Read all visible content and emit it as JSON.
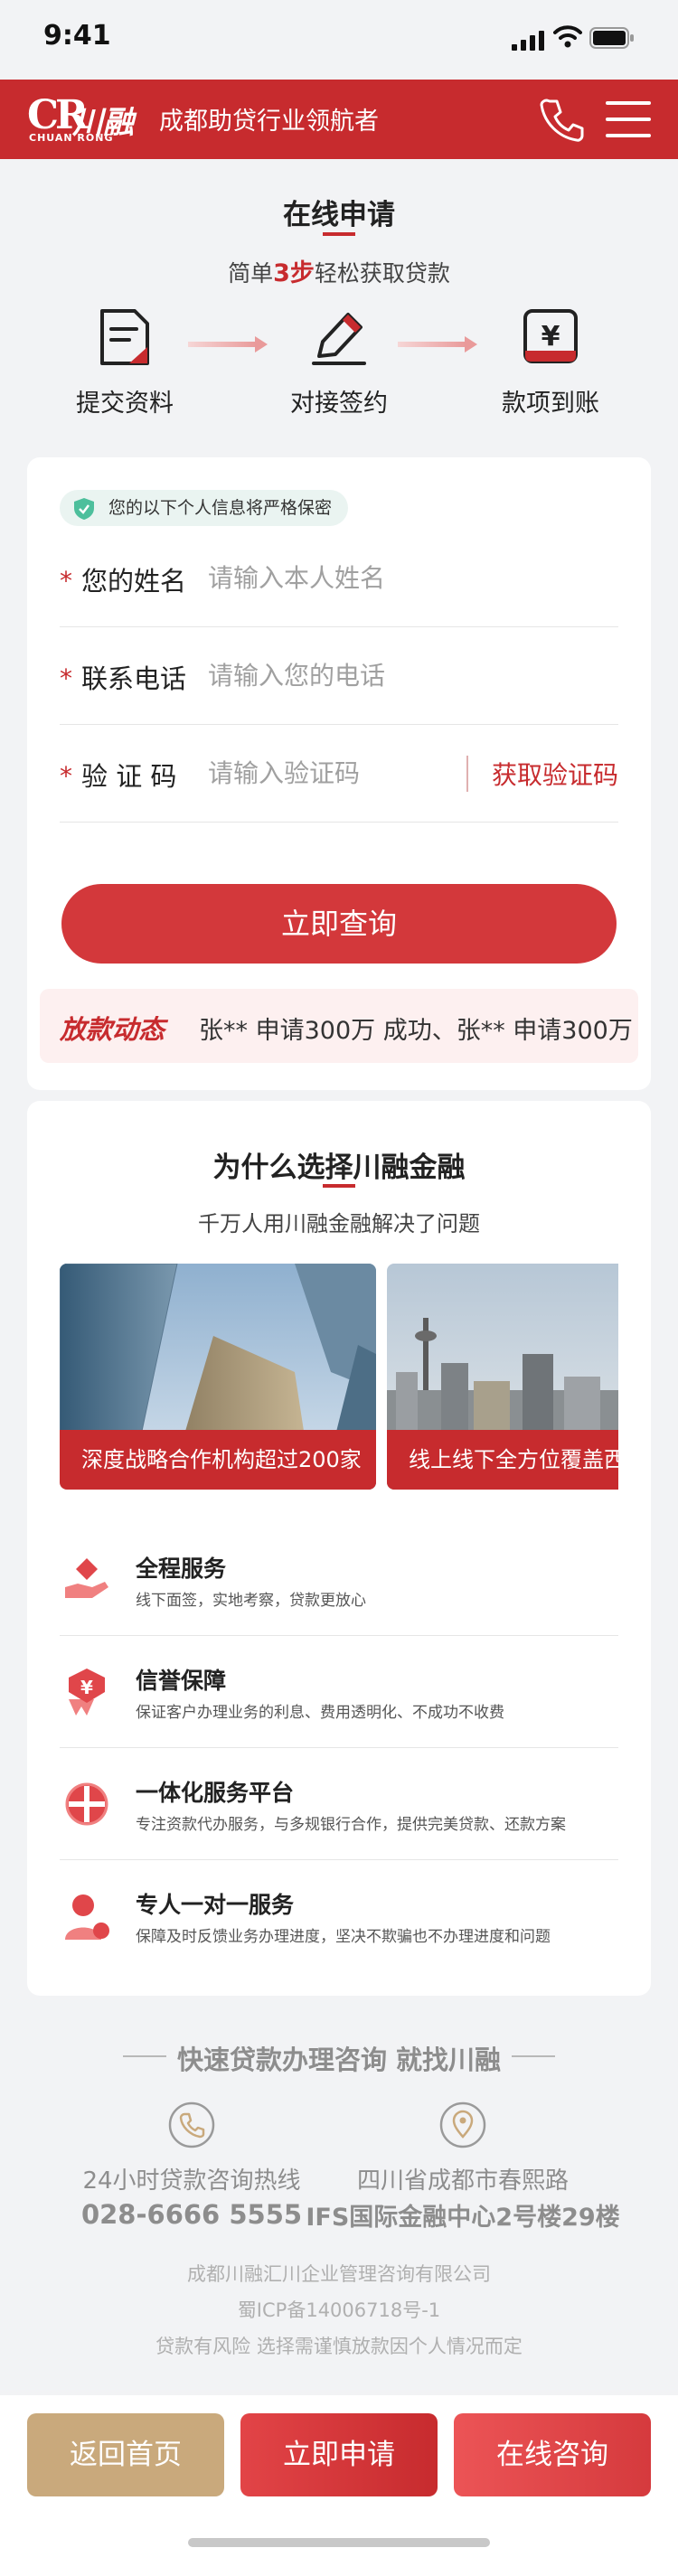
{
  "status_bar": {
    "time": "9:41"
  },
  "header": {
    "logo_mark": "CR",
    "logo_cn": "川融",
    "logo_en": "CHUAN RONG",
    "slogan": "成都助贷行业领航者",
    "brand_color": "#c72b2e"
  },
  "apply": {
    "title": "在线申请",
    "subtitle_pre": "简单",
    "subtitle_highlight": "3步",
    "subtitle_post": "轻松获取贷款",
    "steps": [
      {
        "label": "提交资料",
        "icon": "document-icon"
      },
      {
        "label": "对接签约",
        "icon": "pen-icon"
      },
      {
        "label": "款项到账",
        "icon": "yen-card-icon"
      }
    ]
  },
  "form": {
    "privacy_note": "您的以下个人信息将严格保密",
    "name_label": "您的姓名",
    "name_placeholder": "请输入本人姓名",
    "phone_label": "联系电话",
    "phone_placeholder": "请输入您的电话",
    "code_label": "验 证 码",
    "code_placeholder": "请输入验证码",
    "get_code": "获取验证码",
    "submit": "立即查询",
    "ticker_tag": "放款动态",
    "ticker_msg": "张**  申请300万 成功、张**  申请300万"
  },
  "why": {
    "title": "为什么选择川融金融",
    "subtitle": "千万人用川融金融解决了问题",
    "photos": [
      {
        "caption": "深度战略合作机构超过200家"
      },
      {
        "caption": "线上线下全方位覆盖西"
      }
    ],
    "features": [
      {
        "title": "全程服务",
        "desc": "线下面签，实地考察，贷款更放心",
        "icon": "hand-heart-icon"
      },
      {
        "title": "信誉保障",
        "desc": "保证客户办理业务的利息、费用透明化、不成功不收费",
        "icon": "yen-badge-icon"
      },
      {
        "title": "一体化服务平台",
        "desc": "专注资款代办服务，与多规银行合作，提供完美贷款、还款方案",
        "icon": "platform-icon"
      },
      {
        "title": "专人一对一服务",
        "desc": "保障及时反馈业务办理进度，坚决不欺骗也不办理进度和问题",
        "icon": "agent-icon"
      }
    ]
  },
  "footer": {
    "title": "快速贷款办理咨询 就找川融",
    "hotline_label": "24小时贷款咨询热线",
    "hotline": "028-6666 5555",
    "address_line1": "四川省成都市春熙路",
    "address_line2": "IFS国际金融中心2号楼29楼",
    "company": "成都川融汇川企业管理咨询有限公司",
    "icp": "蜀ICP备14006718号-1",
    "risk": "贷款有风险  选择需谨慎放款因个人情况而定"
  },
  "bottom_bar": {
    "home": "返回首页",
    "apply": "立即申请",
    "consult": "在线咨询",
    "home_color": "#c9a97c",
    "apply_color": "#d3383b",
    "consult_color": "#e2494b"
  }
}
